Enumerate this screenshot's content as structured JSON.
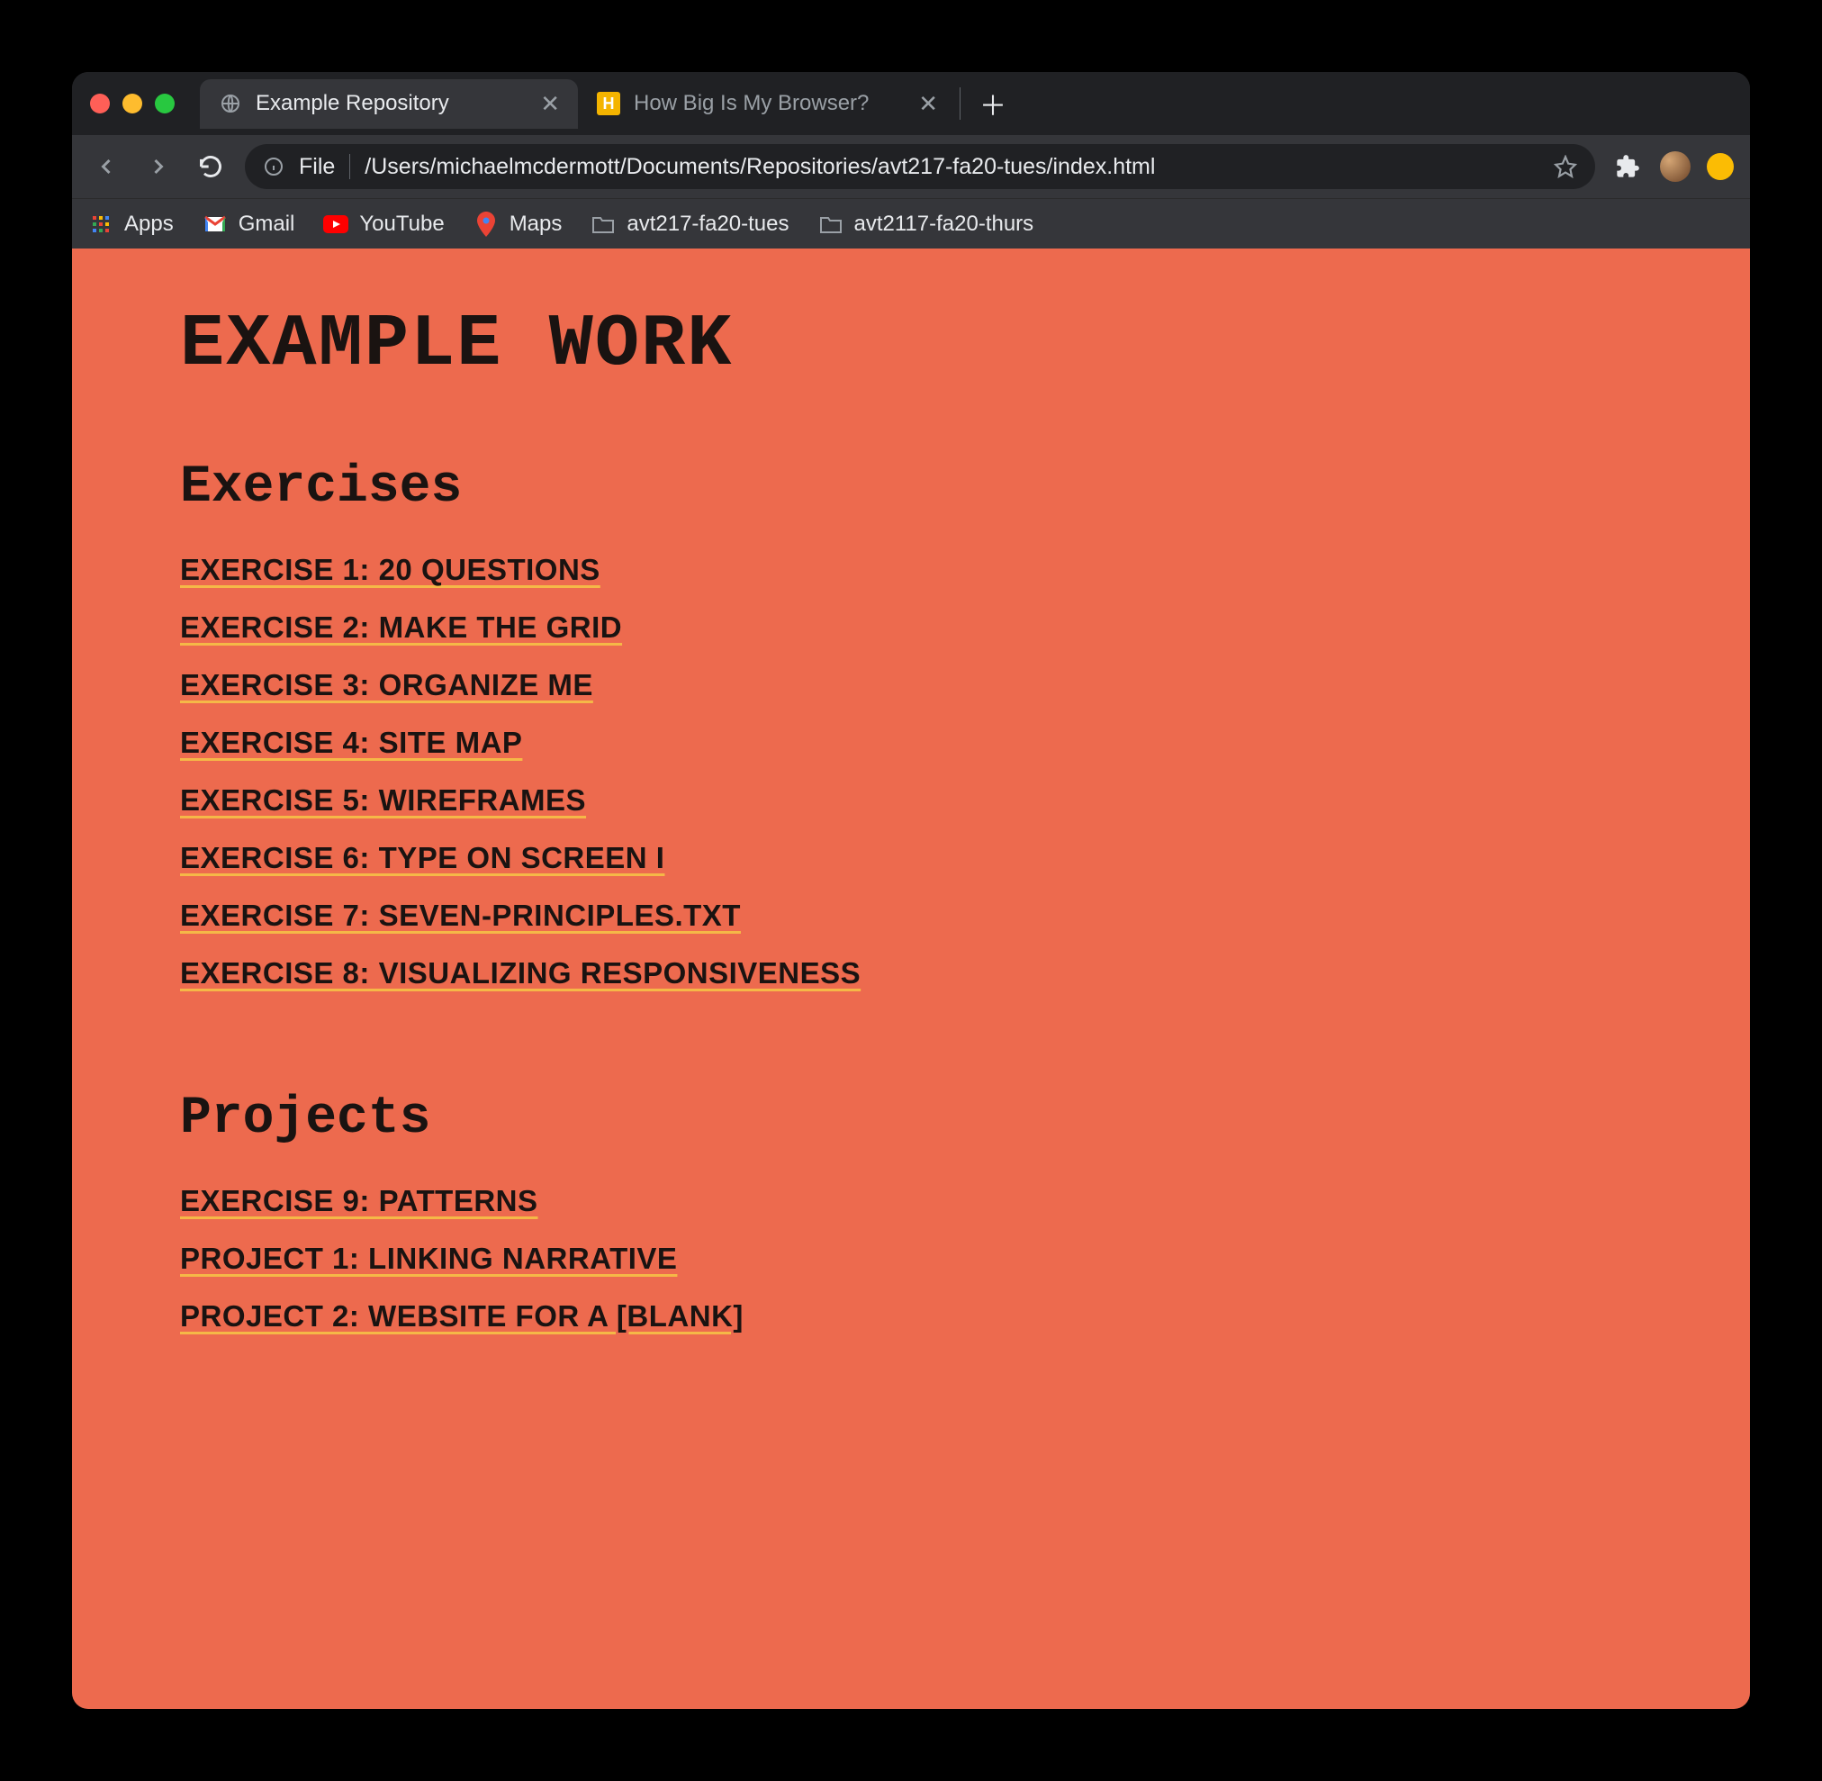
{
  "tabs": [
    {
      "title": "Example Repository",
      "active": true
    },
    {
      "title": "How Big Is My Browser?",
      "active": false
    }
  ],
  "addressbar": {
    "scheme": "File",
    "path": "/Users/michaelmcdermott/Documents/Repositories/avt217-fa20-tues/index.html"
  },
  "bookmarks": [
    {
      "label": "Apps",
      "icon": "apps"
    },
    {
      "label": "Gmail",
      "icon": "gmail"
    },
    {
      "label": "YouTube",
      "icon": "youtube"
    },
    {
      "label": "Maps",
      "icon": "maps"
    },
    {
      "label": "avt217-fa20-tues",
      "icon": "folder"
    },
    {
      "label": "avt2117-fa20-thurs",
      "icon": "folder"
    }
  ],
  "page": {
    "title": "EXAMPLE WORK",
    "sections": [
      {
        "title": "Exercises",
        "items": [
          "EXERCISE 1: 20 QUESTIONS",
          "EXERCISE 2: MAKE THE GRID",
          "EXERCISE 3: ORGANIZE ME",
          "EXERCISE 4: SITE MAP",
          "EXERCISE 5: WIREFRAMES",
          "EXERCISE 6: TYPE ON SCREEN I",
          "EXERCISE 7: SEVEN-PRINCIPLES.TXT",
          "EXERCISE 8: VISUALIZING RESPONSIVENESS"
        ]
      },
      {
        "title": "Projects",
        "items": [
          "EXERCISE 9: PATTERNS",
          "PROJECT 1: LINKING NARRATIVE",
          "PROJECT 2: WEBSITE FOR A [BLANK]"
        ]
      }
    ]
  }
}
